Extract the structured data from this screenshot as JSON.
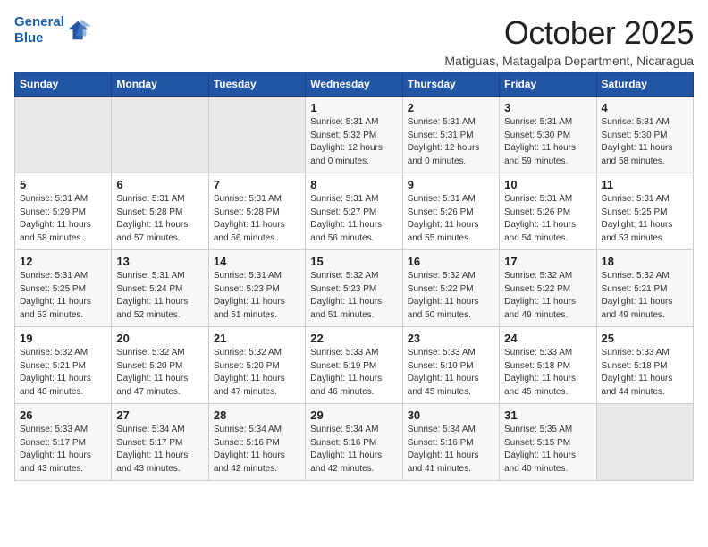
{
  "logo": {
    "line1": "General",
    "line2": "Blue"
  },
  "title": "October 2025",
  "subtitle": "Matiguas, Matagalpa Department, Nicaragua",
  "days_of_week": [
    "Sunday",
    "Monday",
    "Tuesday",
    "Wednesday",
    "Thursday",
    "Friday",
    "Saturday"
  ],
  "weeks": [
    [
      {
        "day": "",
        "sunrise": "",
        "sunset": "",
        "daylight": ""
      },
      {
        "day": "",
        "sunrise": "",
        "sunset": "",
        "daylight": ""
      },
      {
        "day": "",
        "sunrise": "",
        "sunset": "",
        "daylight": ""
      },
      {
        "day": "1",
        "sunrise": "Sunrise: 5:31 AM",
        "sunset": "Sunset: 5:32 PM",
        "daylight": "Daylight: 12 hours and 0 minutes."
      },
      {
        "day": "2",
        "sunrise": "Sunrise: 5:31 AM",
        "sunset": "Sunset: 5:31 PM",
        "daylight": "Daylight: 12 hours and 0 minutes."
      },
      {
        "day": "3",
        "sunrise": "Sunrise: 5:31 AM",
        "sunset": "Sunset: 5:30 PM",
        "daylight": "Daylight: 11 hours and 59 minutes."
      },
      {
        "day": "4",
        "sunrise": "Sunrise: 5:31 AM",
        "sunset": "Sunset: 5:30 PM",
        "daylight": "Daylight: 11 hours and 58 minutes."
      }
    ],
    [
      {
        "day": "5",
        "sunrise": "Sunrise: 5:31 AM",
        "sunset": "Sunset: 5:29 PM",
        "daylight": "Daylight: 11 hours and 58 minutes."
      },
      {
        "day": "6",
        "sunrise": "Sunrise: 5:31 AM",
        "sunset": "Sunset: 5:28 PM",
        "daylight": "Daylight: 11 hours and 57 minutes."
      },
      {
        "day": "7",
        "sunrise": "Sunrise: 5:31 AM",
        "sunset": "Sunset: 5:28 PM",
        "daylight": "Daylight: 11 hours and 56 minutes."
      },
      {
        "day": "8",
        "sunrise": "Sunrise: 5:31 AM",
        "sunset": "Sunset: 5:27 PM",
        "daylight": "Daylight: 11 hours and 56 minutes."
      },
      {
        "day": "9",
        "sunrise": "Sunrise: 5:31 AM",
        "sunset": "Sunset: 5:26 PM",
        "daylight": "Daylight: 11 hours and 55 minutes."
      },
      {
        "day": "10",
        "sunrise": "Sunrise: 5:31 AM",
        "sunset": "Sunset: 5:26 PM",
        "daylight": "Daylight: 11 hours and 54 minutes."
      },
      {
        "day": "11",
        "sunrise": "Sunrise: 5:31 AM",
        "sunset": "Sunset: 5:25 PM",
        "daylight": "Daylight: 11 hours and 53 minutes."
      }
    ],
    [
      {
        "day": "12",
        "sunrise": "Sunrise: 5:31 AM",
        "sunset": "Sunset: 5:25 PM",
        "daylight": "Daylight: 11 hours and 53 minutes."
      },
      {
        "day": "13",
        "sunrise": "Sunrise: 5:31 AM",
        "sunset": "Sunset: 5:24 PM",
        "daylight": "Daylight: 11 hours and 52 minutes."
      },
      {
        "day": "14",
        "sunrise": "Sunrise: 5:31 AM",
        "sunset": "Sunset: 5:23 PM",
        "daylight": "Daylight: 11 hours and 51 minutes."
      },
      {
        "day": "15",
        "sunrise": "Sunrise: 5:32 AM",
        "sunset": "Sunset: 5:23 PM",
        "daylight": "Daylight: 11 hours and 51 minutes."
      },
      {
        "day": "16",
        "sunrise": "Sunrise: 5:32 AM",
        "sunset": "Sunset: 5:22 PM",
        "daylight": "Daylight: 11 hours and 50 minutes."
      },
      {
        "day": "17",
        "sunrise": "Sunrise: 5:32 AM",
        "sunset": "Sunset: 5:22 PM",
        "daylight": "Daylight: 11 hours and 49 minutes."
      },
      {
        "day": "18",
        "sunrise": "Sunrise: 5:32 AM",
        "sunset": "Sunset: 5:21 PM",
        "daylight": "Daylight: 11 hours and 49 minutes."
      }
    ],
    [
      {
        "day": "19",
        "sunrise": "Sunrise: 5:32 AM",
        "sunset": "Sunset: 5:21 PM",
        "daylight": "Daylight: 11 hours and 48 minutes."
      },
      {
        "day": "20",
        "sunrise": "Sunrise: 5:32 AM",
        "sunset": "Sunset: 5:20 PM",
        "daylight": "Daylight: 11 hours and 47 minutes."
      },
      {
        "day": "21",
        "sunrise": "Sunrise: 5:32 AM",
        "sunset": "Sunset: 5:20 PM",
        "daylight": "Daylight: 11 hours and 47 minutes."
      },
      {
        "day": "22",
        "sunrise": "Sunrise: 5:33 AM",
        "sunset": "Sunset: 5:19 PM",
        "daylight": "Daylight: 11 hours and 46 minutes."
      },
      {
        "day": "23",
        "sunrise": "Sunrise: 5:33 AM",
        "sunset": "Sunset: 5:19 PM",
        "daylight": "Daylight: 11 hours and 45 minutes."
      },
      {
        "day": "24",
        "sunrise": "Sunrise: 5:33 AM",
        "sunset": "Sunset: 5:18 PM",
        "daylight": "Daylight: 11 hours and 45 minutes."
      },
      {
        "day": "25",
        "sunrise": "Sunrise: 5:33 AM",
        "sunset": "Sunset: 5:18 PM",
        "daylight": "Daylight: 11 hours and 44 minutes."
      }
    ],
    [
      {
        "day": "26",
        "sunrise": "Sunrise: 5:33 AM",
        "sunset": "Sunset: 5:17 PM",
        "daylight": "Daylight: 11 hours and 43 minutes."
      },
      {
        "day": "27",
        "sunrise": "Sunrise: 5:34 AM",
        "sunset": "Sunset: 5:17 PM",
        "daylight": "Daylight: 11 hours and 43 minutes."
      },
      {
        "day": "28",
        "sunrise": "Sunrise: 5:34 AM",
        "sunset": "Sunset: 5:16 PM",
        "daylight": "Daylight: 11 hours and 42 minutes."
      },
      {
        "day": "29",
        "sunrise": "Sunrise: 5:34 AM",
        "sunset": "Sunset: 5:16 PM",
        "daylight": "Daylight: 11 hours and 42 minutes."
      },
      {
        "day": "30",
        "sunrise": "Sunrise: 5:34 AM",
        "sunset": "Sunset: 5:16 PM",
        "daylight": "Daylight: 11 hours and 41 minutes."
      },
      {
        "day": "31",
        "sunrise": "Sunrise: 5:35 AM",
        "sunset": "Sunset: 5:15 PM",
        "daylight": "Daylight: 11 hours and 40 minutes."
      },
      {
        "day": "",
        "sunrise": "",
        "sunset": "",
        "daylight": ""
      }
    ]
  ]
}
